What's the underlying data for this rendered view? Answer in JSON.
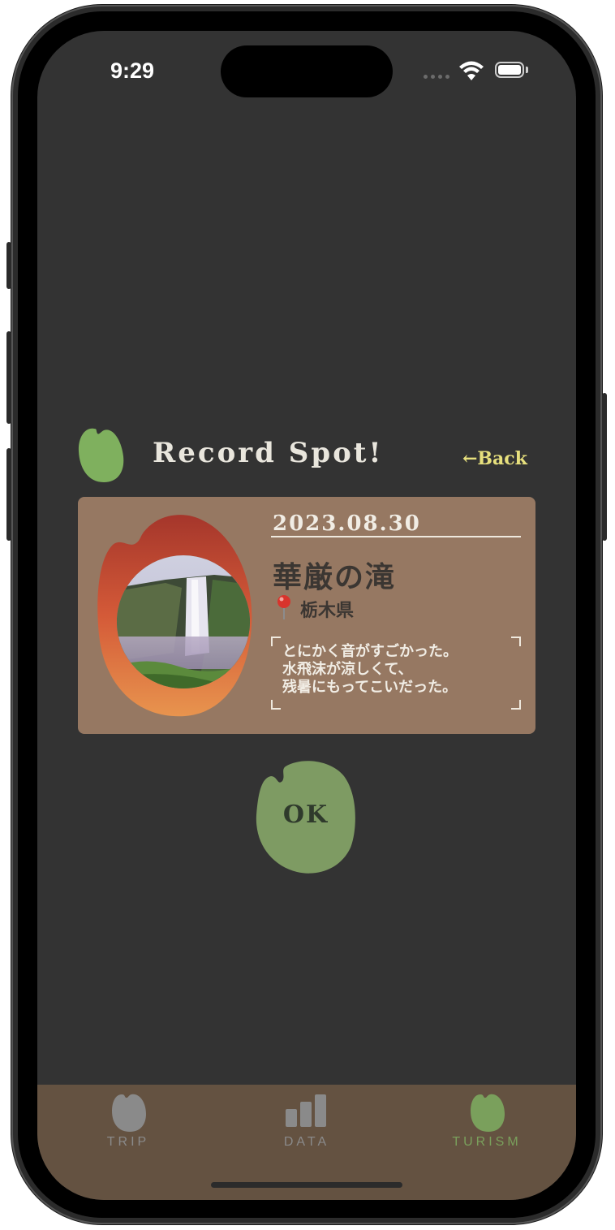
{
  "status_bar": {
    "time": "9:29"
  },
  "header": {
    "title": "Record Spot!",
    "back_label": "←Back"
  },
  "record": {
    "date": "2023.08.30",
    "spot_name": "華厳の滝",
    "prefecture": "栃木県",
    "memo": "とにかく音がすごかった。\n水飛沫が涼しくて、\n残暑にもってこいだった。"
  },
  "actions": {
    "ok_label": "OK"
  },
  "tabbar": {
    "items": [
      {
        "label": "TRIP",
        "icon": "leaf-blob-icon",
        "active": false
      },
      {
        "label": "DATA",
        "icon": "bar-chart-icon",
        "active": false
      },
      {
        "label": "TURISM",
        "icon": "leaf-blob-icon",
        "active": true
      }
    ]
  },
  "colors": {
    "background": "#333333",
    "card": "#967862",
    "accent_green": "#7fb05e",
    "ok_green": "#7e9b63",
    "back_yellow": "#e7e07d",
    "tabbar": "#645241",
    "tab_active": "#7aa05c",
    "tab_inactive": "#8a8a8a"
  }
}
